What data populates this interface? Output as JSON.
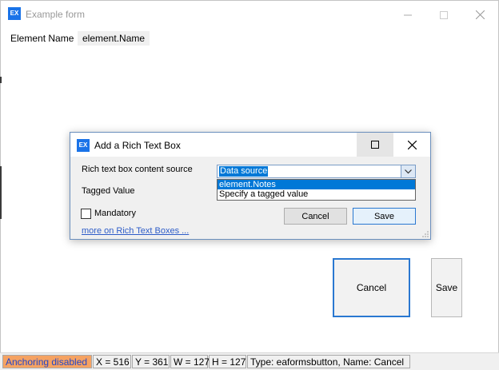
{
  "window": {
    "title": "Example form",
    "icon_text": "EX"
  },
  "form": {
    "element_name_label": "Element Name",
    "element_name_value": "element.Name"
  },
  "form_buttons": {
    "cancel": "Cancel",
    "save": "Save"
  },
  "dialog": {
    "title": "Add a Rich Text Box",
    "icon_text": "EX",
    "source_label": "Rich text box content source",
    "source_selected": "Data source",
    "tagged_value_label": "Tagged Value",
    "options": [
      "element.Notes",
      "Specify a tagged value"
    ],
    "mandatory_label": "Mandatory",
    "link_text": "more on Rich Text Boxes ...",
    "cancel_label": "Cancel",
    "save_label": "Save"
  },
  "statusbar": {
    "anchoring": "Anchoring disabled",
    "x": "X = 516",
    "y": "Y = 361",
    "w": "W = 127",
    "h": "H = 127",
    "type": "Type: eaformsbutton, Name: Cancel"
  },
  "colors": {
    "accent": "#0078d7",
    "anchoring_bg": "#f5a262",
    "anchoring_text": "#2546c6",
    "link": "#2d5cc8"
  }
}
